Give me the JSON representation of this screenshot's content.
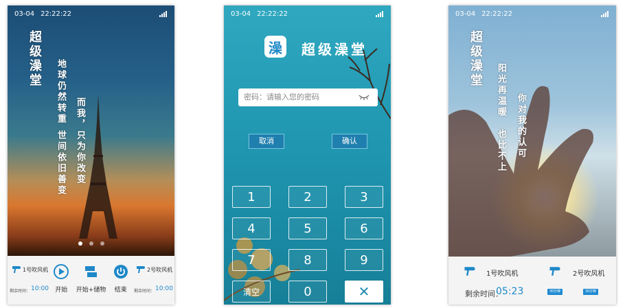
{
  "status": {
    "date": "03-04",
    "time": "22:22:22"
  },
  "poem": {
    "title": "超级澡堂",
    "screen1_lines": [
      "地球仍然转重",
      "世间依旧善变",
      "而我，只为你改变"
    ],
    "screen3_lines": [
      "阳光再温暖",
      "也比不上",
      "你对我的认可"
    ]
  },
  "carousel": {
    "pages": 3,
    "active": 0
  },
  "screen1": {
    "device_left": {
      "name": "1号吹风机",
      "remaining_label": "剩余时间：",
      "remaining_value": "10:00"
    },
    "device_right": {
      "name": "2号吹风机",
      "remaining_label": "剩余时间：",
      "remaining_value": "10:00"
    },
    "actions": [
      {
        "label": "开始",
        "icon": "play-icon"
      },
      {
        "label": "开始+储物",
        "icon": "storage-icon"
      },
      {
        "label": "结束",
        "icon": "power-icon"
      }
    ]
  },
  "screen2": {
    "app_title": "超级澡堂",
    "logo_char": "澡",
    "password_placeholder": "密码：请输入您的密码",
    "cancel_label": "取消",
    "confirm_label": "确认",
    "keys": [
      "1",
      "2",
      "3",
      "4",
      "5",
      "6",
      "7",
      "8",
      "9",
      "清空",
      "0",
      "✕"
    ]
  },
  "screen3": {
    "device_left": {
      "name": "1号吹风机",
      "remaining_label": "剩余时间：",
      "remaining_value": "05:23"
    },
    "device_right": {
      "name": "2号吹风机"
    },
    "tiny_btn_1": "30分钟",
    "tiny_btn_2": "30分钟"
  },
  "colors": {
    "accent": "#1e88c8",
    "teal": "#1f95b0"
  }
}
